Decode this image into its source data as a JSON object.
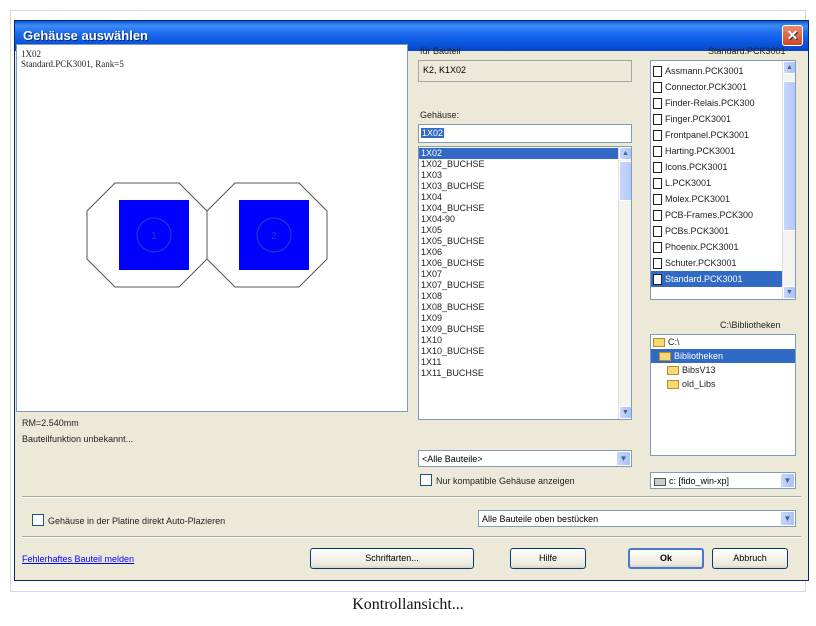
{
  "dialog": {
    "title": "Gehäuse auswählen",
    "close_glyph": "✕"
  },
  "preview": {
    "line1": "1X02",
    "line2": "Standard.PCK3001, Rank=5",
    "pad_labels": [
      "1",
      "2"
    ],
    "pad_color": "#0000ff",
    "rm_label": "RM=2.540mm",
    "function_label": "Bauteilfunktion unbekannt..."
  },
  "part": {
    "label": "für Bauteil",
    "value": "K2, K1X02"
  },
  "housing": {
    "label": "Gehäuse:",
    "input_value": "1X02",
    "items": [
      "1X02",
      "1X02_BUCHSE",
      "1X03",
      "1X03_BUCHSE",
      "1X04",
      "1X04_BUCHSE",
      "1X04-90",
      "1X05",
      "1X05_BUCHSE",
      "1X06",
      "1X06_BUCHSE",
      "1X07",
      "1X07_BUCHSE",
      "1X08",
      "1X08_BUCHSE",
      "1X09",
      "1X09_BUCHSE",
      "1X10",
      "1X10_BUCHSE",
      "1X11",
      "1X11_BUCHSE"
    ],
    "selected_index": 0,
    "filter_value": "<Alle Bauteile>",
    "compatible_label": "Nur kompatible Gehäuse anzeigen"
  },
  "library": {
    "header": "Standard.PCK3001",
    "items": [
      "Assmann.PCK3001",
      "Connector.PCK3001",
      "Finder-Relais.PCK300",
      "Finger.PCK3001",
      "Frontpanel.PCK3001",
      "Harting.PCK3001",
      "Icons.PCK3001",
      "L.PCK3001",
      "Molex.PCK3001",
      "PCB-Frames.PCK300",
      "PCBs.PCK3001",
      "Phoenix.PCK3001",
      "Schuter.PCK3001",
      "Standard.PCK3001"
    ],
    "selected_index": 13,
    "path_label": "C:\\Bibliotheken",
    "folders": [
      "C:\\",
      "Bibliotheken",
      "BibsV13",
      "old_Libs"
    ],
    "selected_folder_index": 1,
    "drive_value": "c: [fido_win-xp]"
  },
  "options": {
    "autoplace_label": "Gehäuse in der Platine direkt Auto-Plazieren",
    "placement_value": "Alle Bauteile oben bestücken"
  },
  "footer": {
    "report_link": "Fehlerhaftes Bauteil melden",
    "fonts_button": "Schriftarten...",
    "help_button": "Hilfe",
    "ok_button": "Ok",
    "cancel_button": "Abbruch"
  },
  "caption": "Kontrollansicht..."
}
